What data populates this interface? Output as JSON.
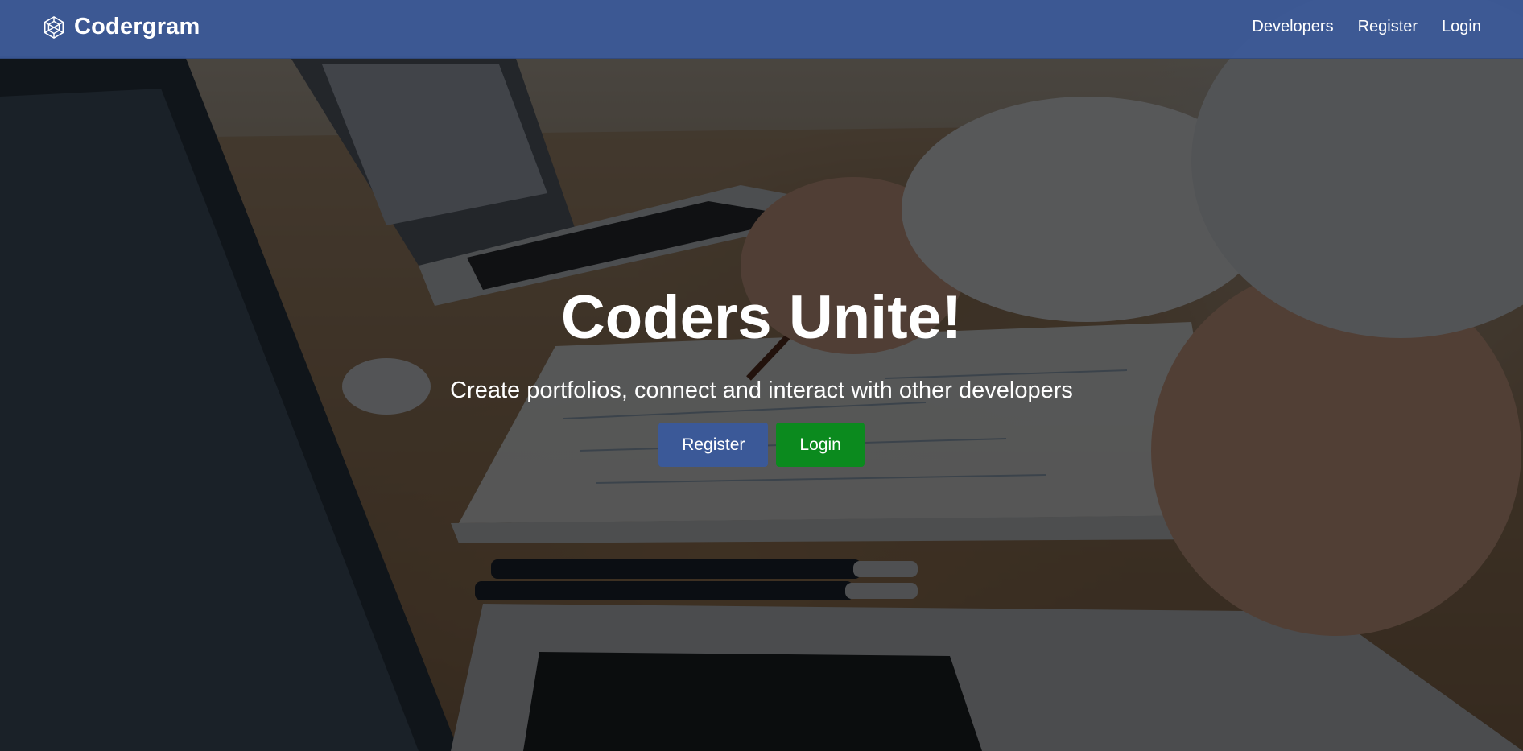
{
  "navbar": {
    "brand": "Codergram",
    "brand_icon": "crystal-wireframe-icon",
    "links": [
      "Developers",
      "Register",
      "Login"
    ],
    "background_color": "#3b5998"
  },
  "landing": {
    "title": "Coders Unite!",
    "subtitle": "Create portfolios, connect and interact with other developers",
    "register_label": "Register",
    "login_label": "Login",
    "register_color": "#3b5998",
    "login_color": "#0b8a1e"
  }
}
